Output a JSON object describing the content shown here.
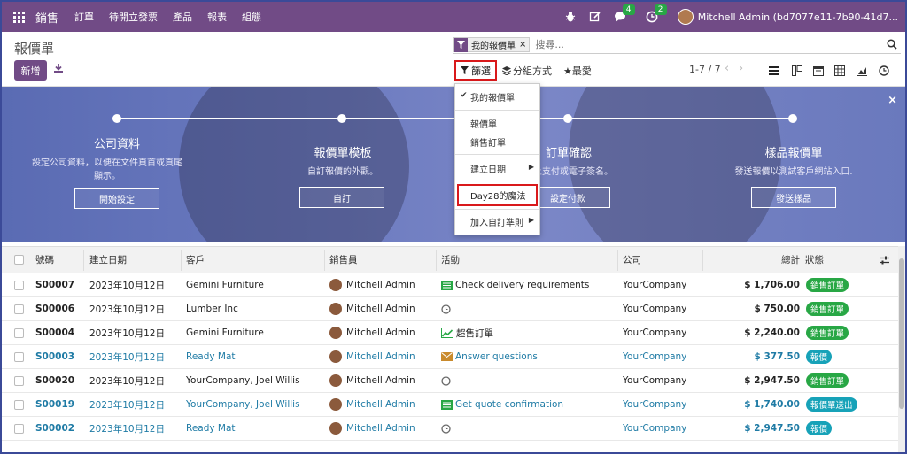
{
  "topbar": {
    "app_name": "銷售",
    "menus": [
      "訂單",
      "待開立發票",
      "產品",
      "報表",
      "組態"
    ],
    "chat_count": "4",
    "activity_count": "2",
    "user": "Mitchell Admin (bd7077e11-7b90-41d7..."
  },
  "control": {
    "breadcrumb": "報價單",
    "new_label": "新增",
    "facet_label": "我的報價單",
    "facet_remove": "×",
    "search_placeholder": "搜尋...",
    "filter_label": "篩選",
    "groupby_label": "分組方式",
    "favorites_label": "最愛",
    "pager": "1-7 / 7"
  },
  "dropdown": {
    "my_quotes": "我的報價單",
    "quotations": "報價單",
    "sales_orders": "銷售訂單",
    "create_date": "建立日期",
    "magic": "Day28的魔法",
    "custom": "加入自訂準則"
  },
  "hero": {
    "steps": [
      {
        "title": "公司資料",
        "desc": "設定公司資料，以便在文件頁首或頁尾顯示。",
        "button": "開始設定"
      },
      {
        "title": "報價單模板",
        "desc": "自訂報價的外觀。",
        "button": "自訂"
      },
      {
        "title": "訂單確認",
        "desc": "線上支付或電子簽名。",
        "button": "設定付款"
      },
      {
        "title": "樣品報價單",
        "desc": "發送報價以測試客戶網站入口.",
        "button": "發送樣品"
      }
    ],
    "close": "×"
  },
  "table": {
    "headers": {
      "number": "號碼",
      "date": "建立日期",
      "customer": "客戶",
      "salesperson": "銷售員",
      "activity": "活動",
      "company": "公司",
      "total": "總計",
      "status": "狀態"
    },
    "rows": [
      {
        "number": "S00007",
        "date": "2023年10月12日",
        "customer": "Gemini Furniture",
        "salesperson": "Mitchell Admin",
        "activity_icon": "list-icon",
        "activity_color": "#28a745",
        "activity": "Check delivery requirements",
        "company": "YourCompany",
        "total": "$ 1,706.00",
        "status": "銷售訂單",
        "status_color": "green",
        "highlight": false
      },
      {
        "number": "S00006",
        "date": "2023年10月12日",
        "customer": "Lumber Inc",
        "salesperson": "Mitchell Admin",
        "activity_icon": "clock-icon",
        "activity_color": "#666666",
        "activity": "",
        "company": "YourCompany",
        "total": "$ 750.00",
        "status": "銷售訂單",
        "status_color": "green",
        "highlight": false
      },
      {
        "number": "S00004",
        "date": "2023年10月12日",
        "customer": "Gemini Furniture",
        "salesperson": "Mitchell Admin",
        "activity_icon": "chart-icon",
        "activity_color": "#28a745",
        "activity": "超售訂單",
        "company": "YourCompany",
        "total": "$ 2,240.00",
        "status": "銷售訂單",
        "status_color": "green",
        "highlight": false
      },
      {
        "number": "S00003",
        "date": "2023年10月12日",
        "customer": "Ready Mat",
        "salesperson": "Mitchell Admin",
        "activity_icon": "envelope-icon",
        "activity_color": "#c98a2c",
        "activity": "Answer questions",
        "company": "YourCompany",
        "total": "$ 377.50",
        "status": "報價",
        "status_color": "teal",
        "highlight": true
      },
      {
        "number": "S00020",
        "date": "2023年10月12日",
        "customer": "YourCompany, Joel Willis",
        "salesperson": "Mitchell Admin",
        "activity_icon": "clock-icon",
        "activity_color": "#666666",
        "activity": "",
        "company": "YourCompany",
        "total": "$ 2,947.50",
        "status": "銷售訂單",
        "status_color": "green",
        "highlight": false
      },
      {
        "number": "S00019",
        "date": "2023年10月12日",
        "customer": "YourCompany, Joel Willis",
        "salesperson": "Mitchell Admin",
        "activity_icon": "list-icon",
        "activity_color": "#28a745",
        "activity": "Get quote confirmation",
        "company": "YourCompany",
        "total": "$ 1,740.00",
        "status": "報價單送出",
        "status_color": "teal",
        "highlight": true
      },
      {
        "number": "S00002",
        "date": "2023年10月12日",
        "customer": "Ready Mat",
        "salesperson": "Mitchell Admin",
        "activity_icon": "clock-icon",
        "activity_color": "#666666",
        "activity": "",
        "company": "YourCompany",
        "total": "$ 2,947.50",
        "status": "報價",
        "status_color": "teal",
        "highlight": true
      }
    ]
  },
  "colors": {
    "brand": "#714b86",
    "highlight_border": "#d9191b",
    "link": "#1f7ba5"
  }
}
